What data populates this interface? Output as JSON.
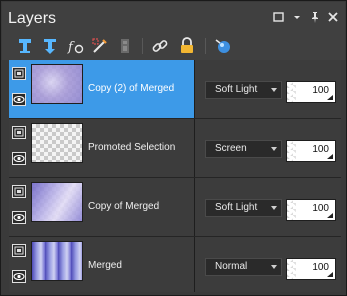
{
  "panel": {
    "title": "Layers",
    "controls": [
      "maximize-icon",
      "dropdown-icon",
      "pin-icon",
      "close-icon"
    ]
  },
  "toolbar": {
    "buttons": [
      "new-raster-layer-icon",
      "new-vector-layer-icon",
      "new-adjustment-layer-icon",
      "edit-selection-icon",
      "delete-layer-icon",
      "link-layers-icon",
      "lock-layer-icon",
      "layer-styles-icon"
    ]
  },
  "layers": [
    {
      "name": "Copy (2) of Merged",
      "blend_mode": "Soft Light",
      "opacity": "100",
      "selected": true,
      "thumbnail": "purple-lavender"
    },
    {
      "name": "Promoted Selection",
      "blend_mode": "Screen",
      "opacity": "100",
      "selected": false,
      "thumbnail": "transparent"
    },
    {
      "name": "Copy of Merged",
      "blend_mode": "Soft Light",
      "opacity": "100",
      "selected": false,
      "thumbnail": "purple-gradient"
    },
    {
      "name": "Merged",
      "blend_mode": "Normal",
      "opacity": "100",
      "selected": false,
      "thumbnail": "blue-stripes"
    }
  ],
  "colors": {
    "selection": "#3d9ae8",
    "panel_bg": "#3a3a3a",
    "toolbar_icon_blue": "#57b7ff",
    "lock_icon": "#f2b632"
  }
}
